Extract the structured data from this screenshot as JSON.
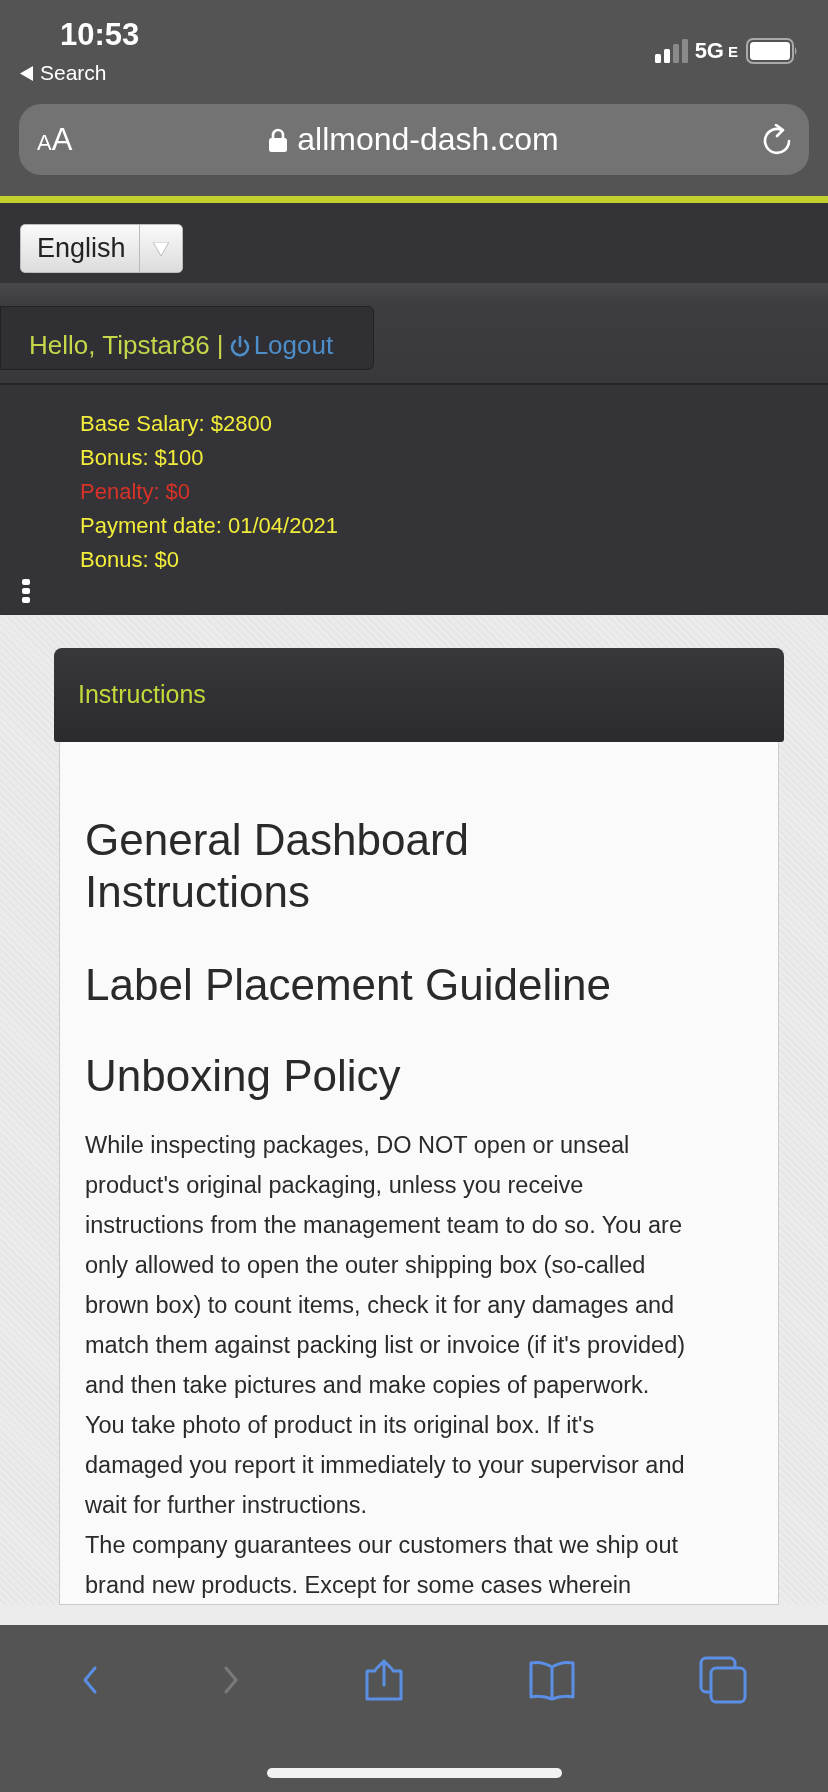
{
  "status_bar": {
    "time": "10:53",
    "back_label": "Search",
    "network": "5G",
    "network_suffix": "E"
  },
  "address_bar": {
    "text_size_button": "AA",
    "url": "allmond-dash.com"
  },
  "language_select": {
    "value": "English"
  },
  "user_bar": {
    "greeting": "Hello, Tipstar86 |",
    "logout": "Logout"
  },
  "salary": [
    {
      "text": "Base Salary: $2800",
      "kind": "normal"
    },
    {
      "text": "Bonus: $100",
      "kind": "normal"
    },
    {
      "text": "Penalty: $0",
      "kind": "penalty"
    },
    {
      "text": "Payment date: 01/04/2021",
      "kind": "normal"
    },
    {
      "text": "Bonus: $0",
      "kind": "normal"
    }
  ],
  "instructions": {
    "title": "Instructions",
    "headings": [
      "General Dashboard Instructions",
      "Label Placement Guideline",
      "Unboxing Policy"
    ],
    "paragraphs": [
      [
        "While inspecting packages, DO NOT open or unseal",
        "product's original packaging, unless you receive",
        "instructions from the management team to do so. You are",
        "only allowed to open the outer shipping box (so-called",
        "brown box) to count items, check it for any damages and",
        "match them against packing list or invoice (if it's provided)",
        "and then take pictures and make copies of paperwork.",
        "You take photo of product in its original box. If it's",
        "damaged you report it immediately to your supervisor and",
        "wait for further instructions."
      ],
      [
        "The company guarantees our customers that we ship out",
        "brand new products. Except for some cases wherein"
      ]
    ]
  },
  "toolbar": [
    {
      "kind": "back",
      "disabled": false
    },
    {
      "kind": "forward",
      "disabled": true
    },
    {
      "kind": "share",
      "disabled": false
    },
    {
      "kind": "bookmarks",
      "disabled": false
    },
    {
      "kind": "tabs",
      "disabled": false
    }
  ]
}
